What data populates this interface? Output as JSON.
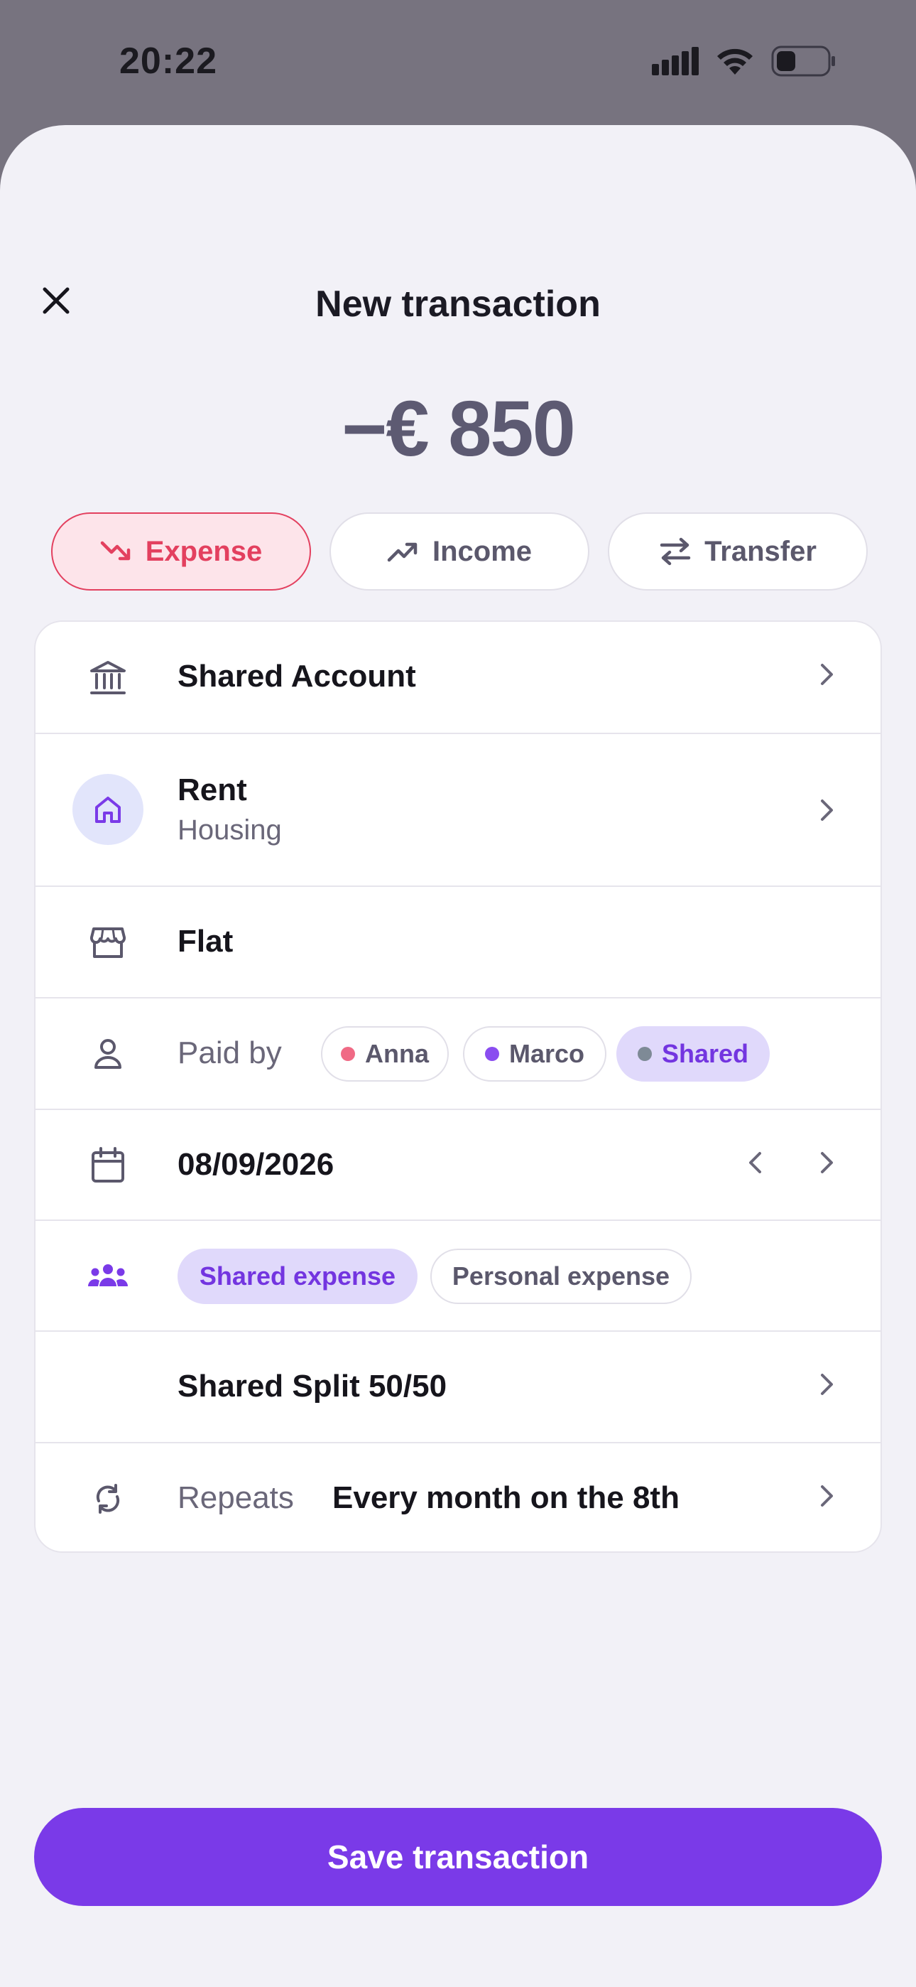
{
  "status": {
    "time": "20:22"
  },
  "header": {
    "title": "New transaction"
  },
  "amount": "−€ 850",
  "type_tabs": [
    {
      "label": "Expense",
      "icon": "trending-down-icon",
      "active": true
    },
    {
      "label": "Income",
      "icon": "trending-up-icon",
      "active": false
    },
    {
      "label": "Transfer",
      "icon": "transfer-arrows-icon",
      "active": false
    }
  ],
  "form": {
    "account": "Shared Account",
    "category": {
      "name": "Rent",
      "group": "Housing"
    },
    "payee": "Flat",
    "paid_by": {
      "label": "Paid by",
      "options": [
        {
          "label": "Anna",
          "dot_color": "#f06a85",
          "selected": false
        },
        {
          "label": "Marco",
          "dot_color": "#8a4df0",
          "selected": false
        },
        {
          "label": "Shared",
          "dot_color": "#7e8a96",
          "selected": true
        }
      ]
    },
    "date": "08/09/2026",
    "expense_type": {
      "options": [
        "Shared expense",
        "Personal expense"
      ],
      "selected": "Shared expense"
    },
    "split": "Shared Split 50/50",
    "repeats": {
      "label": "Repeats",
      "value": "Every month on the 8th"
    }
  },
  "save_label": "Save transaction",
  "colors": {
    "accent": "#7a3ae8",
    "expense": "#e3405f",
    "selected_pill": "#e0d9fb"
  }
}
